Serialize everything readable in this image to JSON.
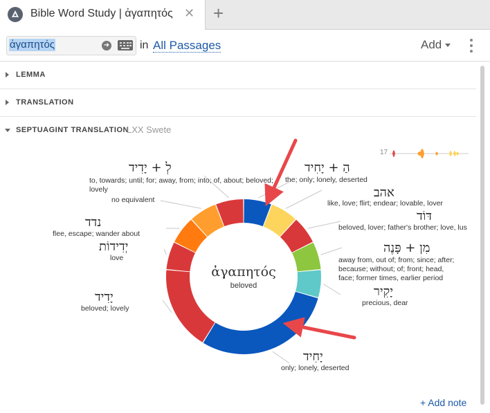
{
  "tab": {
    "title": "Bible Word Study | ἀγαπητός",
    "close": "✕",
    "new": "+"
  },
  "toolbar": {
    "search_value": "ἀγαπητός",
    "in_label": "in",
    "passages": "All Passages",
    "add_label": "Add"
  },
  "sections": [
    {
      "label": "LEMMA",
      "expanded": false
    },
    {
      "label": "TRANSLATION",
      "expanded": false
    },
    {
      "label": "SEPTUAGINT TRANSLATION",
      "sub": "LXX Swete",
      "expanded": true
    }
  ],
  "distribution": {
    "count": "17"
  },
  "chart_data": {
    "type": "donut",
    "center": {
      "word": "ἀγαπητός",
      "gloss": "beloved"
    },
    "slices": [
      {
        "hebrew": "הַ + יָחִיד",
        "gloss": "the; only; lonely, deserted",
        "value": 1,
        "color": "#0a57be"
      },
      {
        "hebrew": "אהב",
        "gloss": "like, love; flirt; endear; lovable, lover",
        "value": 1,
        "color": "#fdd55c"
      },
      {
        "hebrew": "דּוֹד",
        "gloss": "beloved, lover; father's brother; love, lus",
        "value": 1,
        "color": "#d9383a"
      },
      {
        "hebrew": "מִן + פָּנֶה",
        "gloss": "away from, out of; from; since; after; because; without; of; front; head, face; former times, earlier period",
        "value": 1,
        "color": "#8dc63f"
      },
      {
        "hebrew": "יָקִיר",
        "gloss": "precious, dear",
        "value": 1,
        "color": "#5ec9c8"
      },
      {
        "hebrew": "יָחִיד",
        "gloss": "only; lonely, deserted",
        "value": 5,
        "color": "#0a57be"
      },
      {
        "hebrew": "יָדִיד",
        "gloss": "beloved; lovely",
        "value": 3,
        "color": "#d9383a"
      },
      {
        "hebrew": "יְדִידוֹת",
        "gloss": "love",
        "value": 1,
        "color": "#d9383a"
      },
      {
        "hebrew": "נדד",
        "gloss": "flee, escape; wander about",
        "value": 1,
        "color": "#ff7b10"
      },
      {
        "hebrew": "",
        "gloss": "no equivalent",
        "value": 1,
        "color": "#ff9e2e"
      },
      {
        "hebrew": "לְ + יָדִיד",
        "gloss": "to, towards; until; for; away, from; into; of, about; beloved; lovely",
        "value": 1,
        "color": "#d9383a"
      }
    ]
  },
  "add_note": "+ Add note"
}
